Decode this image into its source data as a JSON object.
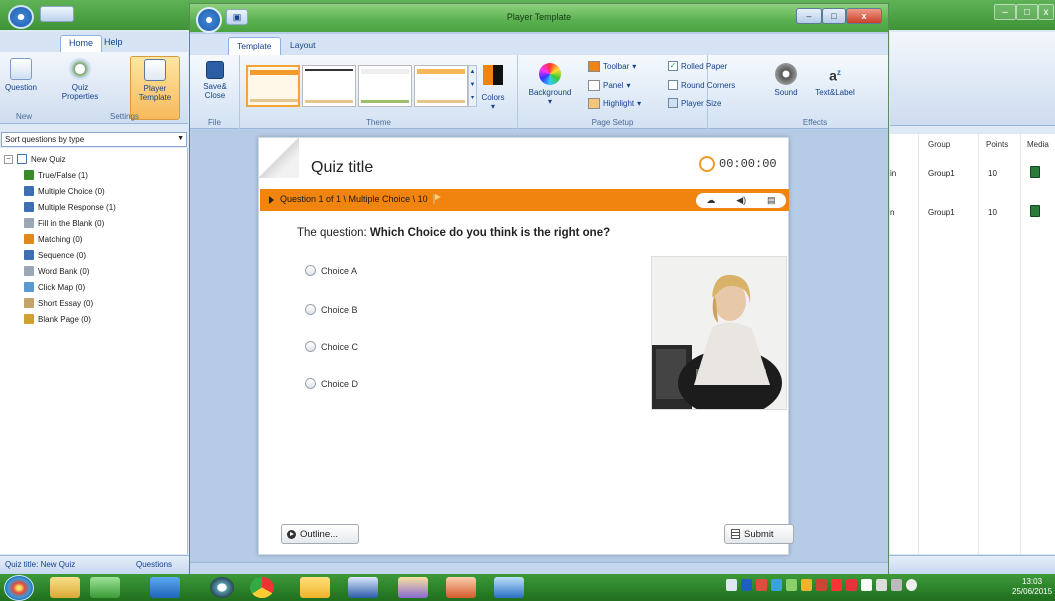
{
  "background_app": {
    "tabs": [
      "Home",
      "Help"
    ],
    "ribbon": {
      "question_label": "Question",
      "quiz_props_label": "Quiz\nProperties",
      "player_template_label": "Player\nTemplate",
      "group_new": "New",
      "group_settings": "Settings"
    },
    "sort_dropdown": "Sort questions by type",
    "tree": {
      "root": "New Quiz",
      "items": [
        {
          "label": "True/False  (1)",
          "color": "#3a8a2a"
        },
        {
          "label": "Multiple Choice  (0)",
          "color": "#3d6fb3"
        },
        {
          "label": "Multiple Response  (1)",
          "color": "#3d6fb3"
        },
        {
          "label": "Fill in the Blank  (0)",
          "color": "#9aa7b6"
        },
        {
          "label": "Matching  (0)",
          "color": "#e08a1e"
        },
        {
          "label": "Sequence  (0)",
          "color": "#3d6fb3"
        },
        {
          "label": "Word Bank  (0)",
          "color": "#9aa7b6"
        },
        {
          "label": "Click Map  (0)",
          "color": "#5a9ad0"
        },
        {
          "label": "Short Essay  (0)",
          "color": "#c2a46a"
        },
        {
          "label": "Blank Page  (0)",
          "color": "#d0a030"
        }
      ]
    },
    "status_title": "Quiz title: New Quiz",
    "status_questions": "Questions",
    "grid": {
      "headers": [
        "Group",
        "Points",
        "Media"
      ],
      "rows": [
        {
          "trunc": "in",
          "group": "Group1",
          "points": "10"
        },
        {
          "trunc": "n",
          "group": "Group1",
          "points": "10"
        }
      ]
    }
  },
  "window": {
    "title": "Player Template",
    "tabs": [
      "Template",
      "Layout"
    ],
    "ribbon": {
      "save_close": "Save&\nClose",
      "group_file": "File",
      "group_theme": "Theme",
      "colors": "Colors",
      "background": "Background",
      "toolbar": "Toolbar",
      "panel": "Panel",
      "highlight": "Highlight",
      "rolled_paper": "Rolled Paper",
      "round_corners": "Round Corners",
      "player_size": "Player Size",
      "group_page_setup": "Page Setup",
      "sound": "Sound",
      "text_label": "Text&Label",
      "group_effects": "Effects"
    },
    "swatches": {
      "toolbar": "#f1830f",
      "panel": "#ffffff",
      "highlight": "#f5c57a"
    },
    "checkboxes": {
      "rolled_paper": true,
      "round_corners": false
    }
  },
  "quiz": {
    "title": "Quiz title",
    "timer": "00:00:00",
    "question_info": "Question 1 of 1 \\ Multiple Choice \\ 10",
    "question_prefix": "The question: ",
    "question_bold": "Which Choice do you think is the right one?",
    "choices": [
      "Choice A",
      "Choice B",
      "Choice C",
      "Choice D"
    ],
    "outline_button": "Outline...",
    "submit_button": "Submit"
  },
  "taskbar": {
    "time": "13:03",
    "date": "25/06/2015"
  }
}
